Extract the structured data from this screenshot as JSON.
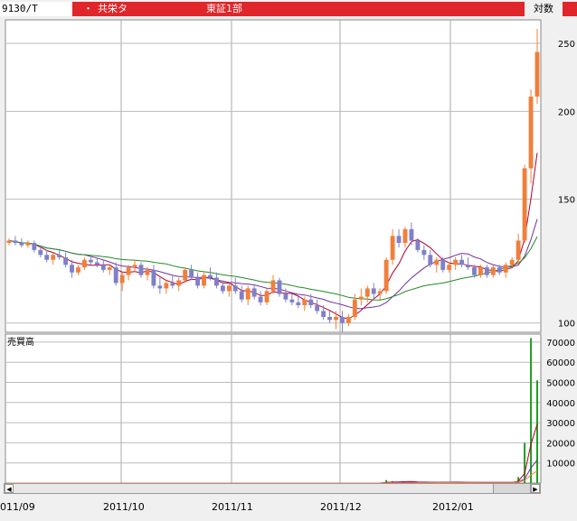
{
  "header": {
    "code": "9130/T",
    "bullet": "・",
    "name": "共栄タ",
    "market": "東証1部",
    "scale": "対数"
  },
  "volume_label": "売買高",
  "x_labels": [
    "011/09",
    "2011/10",
    "2011/11",
    "2011/12",
    "2012/01"
  ],
  "scroll": {
    "left": "◀",
    "right": "▶"
  },
  "colors": {
    "up": "#f07f3c",
    "down": "#8080c8",
    "ma_short": "#b0002a",
    "ma_mid": "#7030a0",
    "ma_long": "#238b23",
    "volume": "#1f9e1f"
  },
  "chart_data": [
    {
      "type": "candlestick",
      "yscale": "log",
      "ylim": [
        97,
        270
      ],
      "yticks": [
        100,
        150,
        200,
        250
      ],
      "candles": [
        [
          130,
          132,
          129,
          131
        ],
        [
          131,
          133,
          129,
          130
        ],
        [
          130,
          132,
          128,
          129
        ],
        [
          129,
          131,
          128,
          130
        ],
        [
          130,
          131,
          126,
          127
        ],
        [
          127,
          129,
          124,
          125
        ],
        [
          125,
          127,
          122,
          123
        ],
        [
          123,
          126,
          121,
          125
        ],
        [
          125,
          127,
          123,
          124
        ],
        [
          124,
          126,
          120,
          121
        ],
        [
          121,
          123,
          116,
          118
        ],
        [
          118,
          121,
          117,
          120
        ],
        [
          120,
          124,
          119,
          123
        ],
        [
          123,
          125,
          121,
          122
        ],
        [
          122,
          124,
          120,
          121
        ],
        [
          121,
          123,
          118,
          119
        ],
        [
          119,
          121,
          117,
          120
        ],
        [
          120,
          122,
          113,
          114
        ],
        [
          114,
          118,
          111,
          117
        ],
        [
          117,
          121,
          115,
          120
        ],
        [
          120,
          123,
          118,
          121
        ],
        [
          121,
          122,
          116,
          117
        ],
        [
          117,
          120,
          115,
          119
        ],
        [
          119,
          121,
          112,
          113
        ],
        [
          113,
          116,
          110,
          112
        ],
        [
          112,
          115,
          110,
          114
        ],
        [
          114,
          117,
          112,
          113
        ],
        [
          113,
          116,
          111,
          115
        ],
        [
          115,
          120,
          114,
          119
        ],
        [
          119,
          121,
          115,
          116
        ],
        [
          116,
          118,
          112,
          113
        ],
        [
          113,
          118,
          112,
          117
        ],
        [
          117,
          120,
          115,
          116
        ],
        [
          116,
          118,
          112,
          113
        ],
        [
          113,
          115,
          110,
          111
        ],
        [
          111,
          114,
          109,
          113
        ],
        [
          113,
          116,
          110,
          111
        ],
        [
          111,
          113,
          107,
          108
        ],
        [
          108,
          113,
          106,
          112
        ],
        [
          112,
          113,
          108,
          109
        ],
        [
          109,
          111,
          106,
          107
        ],
        [
          107,
          112,
          106,
          111
        ],
        [
          111,
          117,
          110,
          115
        ],
        [
          115,
          116,
          109,
          110
        ],
        [
          110,
          112,
          107,
          108
        ],
        [
          108,
          110,
          106,
          107
        ],
        [
          107,
          109,
          105,
          106
        ],
        [
          106,
          109,
          104,
          108
        ],
        [
          108,
          110,
          105,
          106
        ],
        [
          106,
          108,
          103,
          104
        ],
        [
          104,
          106,
          101,
          102
        ],
        [
          102,
          104,
          100,
          101
        ],
        [
          101,
          104,
          98,
          102
        ],
        [
          102,
          104,
          97,
          100
        ],
        [
          100,
          103,
          99,
          102
        ],
        [
          102,
          110,
          101,
          108
        ],
        [
          108,
          112,
          106,
          109
        ],
        [
          109,
          113,
          107,
          112
        ],
        [
          112,
          114,
          108,
          110
        ],
        [
          110,
          112,
          108,
          111
        ],
        [
          111,
          124,
          110,
          123
        ],
        [
          123,
          136,
          121,
          133
        ],
        [
          133,
          136,
          128,
          130
        ],
        [
          130,
          137,
          128,
          136
        ],
        [
          136,
          139,
          129,
          131
        ],
        [
          131,
          132,
          126,
          127
        ],
        [
          127,
          129,
          123,
          125
        ],
        [
          125,
          127,
          120,
          121
        ],
        [
          121,
          124,
          118,
          123
        ],
        [
          123,
          124,
          118,
          119
        ],
        [
          119,
          122,
          118,
          121
        ],
        [
          121,
          124,
          119,
          123
        ],
        [
          123,
          125,
          120,
          121
        ],
        [
          121,
          124,
          119,
          120
        ],
        [
          120,
          121,
          116,
          117
        ],
        [
          117,
          121,
          116,
          120
        ],
        [
          120,
          121,
          116,
          117
        ],
        [
          117,
          121,
          116,
          120
        ],
        [
          120,
          121,
          117,
          118
        ],
        [
          118,
          122,
          116,
          121
        ],
        [
          121,
          124,
          120,
          123
        ],
        [
          123,
          134,
          121,
          131
        ],
        [
          131,
          168,
          130,
          166
        ],
        [
          166,
          215,
          158,
          210
        ],
        [
          210,
          262,
          205,
          243
        ]
      ],
      "volume": [
        0,
        0,
        0,
        0,
        0,
        0,
        0,
        0,
        0,
        0,
        0,
        0,
        0,
        0,
        0,
        0,
        0,
        0,
        0,
        0,
        0,
        0,
        0,
        0,
        0,
        0,
        0,
        0,
        0,
        0,
        0,
        0,
        0,
        0,
        0,
        0,
        0,
        0,
        0,
        0,
        0,
        0,
        0,
        0,
        0,
        0,
        0,
        0,
        0,
        0,
        0,
        0,
        0,
        0,
        0,
        0,
        0,
        0,
        0,
        0,
        1500,
        900,
        600,
        500,
        500,
        400,
        400,
        400,
        300,
        300,
        300,
        300,
        300,
        300,
        300,
        300,
        300,
        300,
        300,
        300,
        500,
        3000,
        20000,
        72000,
        51000
      ],
      "volume_ylim": [
        0,
        74000
      ],
      "volume_yticks": [
        10000,
        20000,
        30000,
        40000,
        50000,
        60000,
        70000
      ]
    }
  ]
}
